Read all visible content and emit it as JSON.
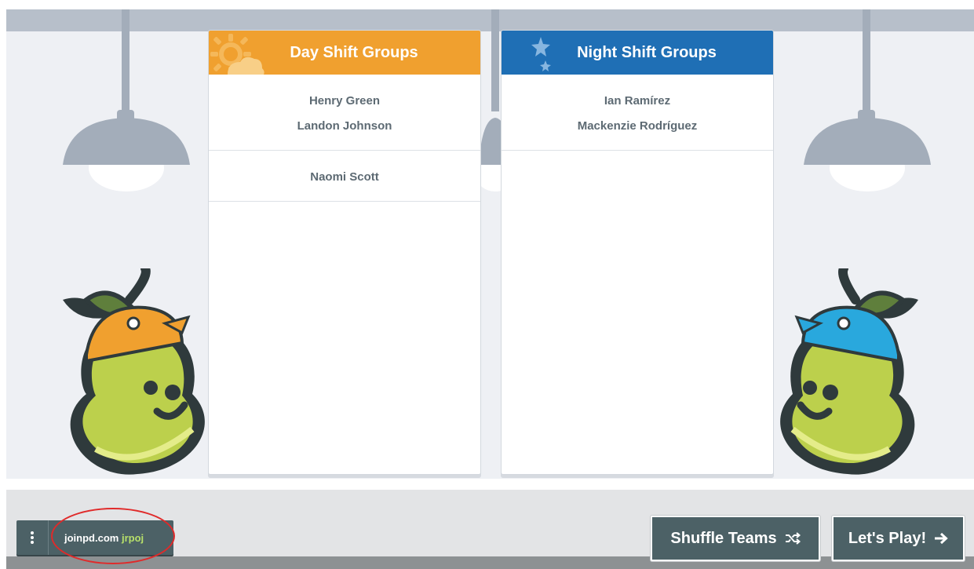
{
  "teams": [
    {
      "title": "Day Shift Groups",
      "icon": "sun-icon",
      "color": "#f0a02f",
      "groups": [
        {
          "members": [
            "Henry Green",
            "Landon Johnson"
          ]
        },
        {
          "members": [
            "Naomi Scott"
          ]
        }
      ]
    },
    {
      "title": "Night Shift Groups",
      "icon": "moon-stars-icon",
      "color": "#1f6fb5",
      "groups": [
        {
          "members": [
            "Ian Ramírez",
            "Mackenzie Rodríguez"
          ]
        }
      ]
    }
  ],
  "footer": {
    "menu_icon": "kebab-menu-icon",
    "join_domain": "joinpd.com",
    "join_code": "jrpoj",
    "shuffle_label": "Shuffle Teams",
    "shuffle_icon": "shuffle-icon",
    "play_label": "Let's Play!",
    "play_icon": "arrow-right-icon"
  },
  "colors": {
    "day_header": "#f0a02f",
    "night_header": "#1f6fb5",
    "button_bg": "#4c6166",
    "join_code": "#b7e06a",
    "highlight_ring": "#e02a2a"
  }
}
